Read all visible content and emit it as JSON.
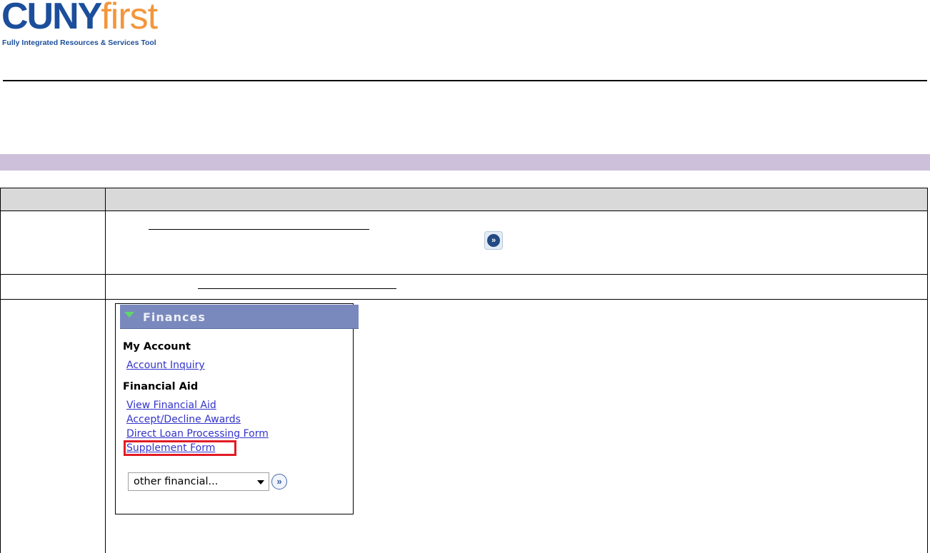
{
  "logo": {
    "word_main": "CUNY",
    "word_accent": "first",
    "tagline": "Fully Integrated Resources & Services Tool"
  },
  "colors": {
    "band": "#ccc0da",
    "header_bg": "#d9d9d9",
    "panel_header": "#7a89bd",
    "link": "#3333cc",
    "highlight": "#e21b23",
    "logo_blue": "#1b4e9b",
    "logo_orange": "#f3963a"
  },
  "icons": {
    "step1_go": "fast-forward-icon",
    "panel_toggle": "triangle-down-icon",
    "select_go": "double-chevron-right-icon"
  },
  "finances_panel": {
    "title": "Finances",
    "section_account": "My Account",
    "link_account_inquiry": "Account Inquiry",
    "section_aid": "Financial Aid",
    "link_view_aid": "View Financial Aid",
    "link_accept_decline": "Accept/Decline Awards",
    "link_direct_loan": "Direct Loan Processing Form",
    "link_supplement": "Supplement Form",
    "select_value": "other financial..."
  }
}
